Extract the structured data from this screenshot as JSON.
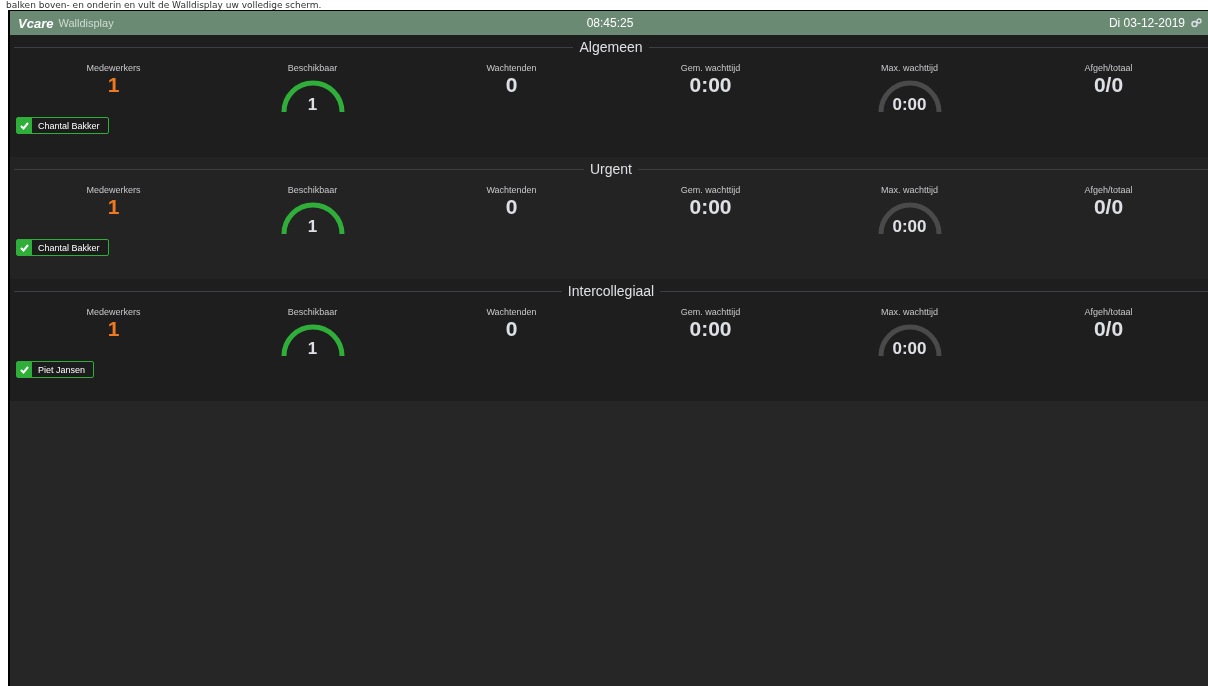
{
  "caption": "balken boven- en onderin en vult de Walldisplay uw volledige scherm.",
  "header": {
    "logo": "Vcare",
    "app_name": "Walldisplay",
    "time": "08:45:25",
    "date": "Di 03-12-2019"
  },
  "sections": [
    {
      "title": "Algemeen",
      "stats": [
        {
          "kind": "accent",
          "label": "Medewerkers",
          "value": "1"
        },
        {
          "kind": "gauge",
          "label": "Beschikbaar",
          "value": "1",
          "active": true
        },
        {
          "kind": "number",
          "label": "Wachtenden",
          "value": "0"
        },
        {
          "kind": "number",
          "label": "Gem. wachttijd",
          "value": "0:00"
        },
        {
          "kind": "gauge",
          "label": "Max. wachttijd",
          "value": "0:00",
          "active": false
        },
        {
          "kind": "number",
          "label": "Afgeh/totaal",
          "value": "0/0"
        }
      ],
      "agents": [
        {
          "name": "Chantal Bakker",
          "checked": true
        }
      ]
    },
    {
      "title": "Urgent",
      "stats": [
        {
          "kind": "accent",
          "label": "Medewerkers",
          "value": "1"
        },
        {
          "kind": "gauge",
          "label": "Beschikbaar",
          "value": "1",
          "active": true
        },
        {
          "kind": "number",
          "label": "Wachtenden",
          "value": "0"
        },
        {
          "kind": "number",
          "label": "Gem. wachttijd",
          "value": "0:00"
        },
        {
          "kind": "gauge",
          "label": "Max. wachttijd",
          "value": "0:00",
          "active": false
        },
        {
          "kind": "number",
          "label": "Afgeh/totaal",
          "value": "0/0"
        }
      ],
      "agents": [
        {
          "name": "Chantal Bakker",
          "checked": true
        }
      ]
    },
    {
      "title": "Intercollegiaal",
      "stats": [
        {
          "kind": "accent",
          "label": "Medewerkers",
          "value": "1"
        },
        {
          "kind": "gauge",
          "label": "Beschikbaar",
          "value": "1",
          "active": true
        },
        {
          "kind": "number",
          "label": "Wachtenden",
          "value": "0"
        },
        {
          "kind": "number",
          "label": "Gem. wachttijd",
          "value": "0:00"
        },
        {
          "kind": "gauge",
          "label": "Max. wachttijd",
          "value": "0:00",
          "active": false
        },
        {
          "kind": "number",
          "label": "Afgeh/totaal",
          "value": "0/0"
        }
      ],
      "agents": [
        {
          "name": "Piet Jansen",
          "checked": true
        }
      ]
    }
  ]
}
